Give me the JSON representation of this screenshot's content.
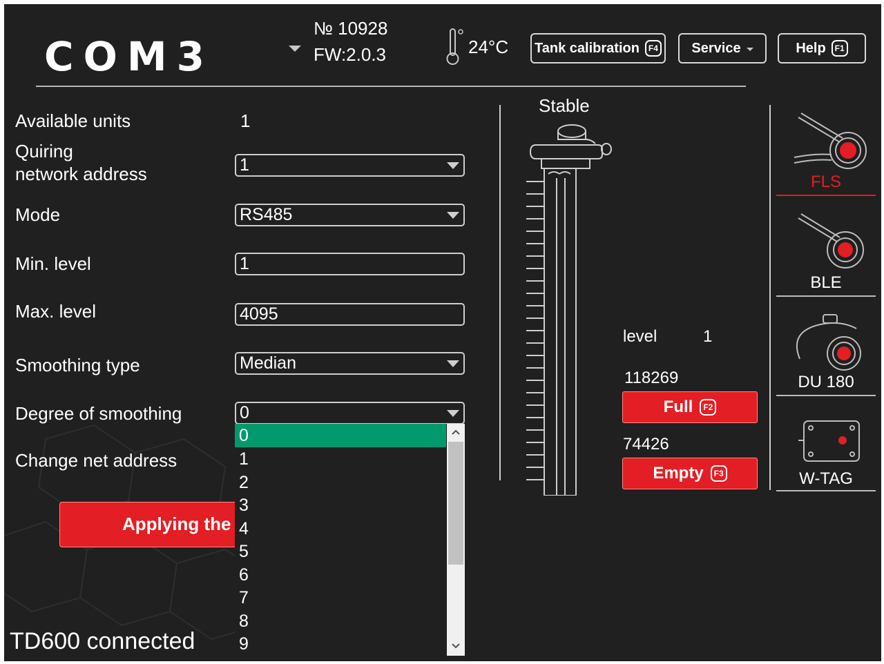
{
  "header": {
    "logo": "COM3",
    "device_number": "№ 10928",
    "firmware": "FW:2.0.3",
    "temperature": "24°C",
    "buttons": {
      "tank_calibration": "Tank calibration",
      "tank_calibration_key": "F4",
      "service": "Service",
      "help": "Help",
      "help_key": "F1"
    }
  },
  "settings": {
    "available_units_label": "Available units",
    "available_units_value": "1",
    "quiring_label_1": "Quiring",
    "quiring_label_2": "network address",
    "quiring_value": "1",
    "mode_label": "Mode",
    "mode_value": "RS485",
    "min_level_label": "Min. level",
    "min_level_value": "1",
    "max_level_label": "Max. level",
    "max_level_value": "4095",
    "smoothing_type_label": "Smoothing type",
    "smoothing_type_value": "Median",
    "degree_label": "Degree of smoothing",
    "degree_value": "0",
    "change_net_label": "Change net address",
    "apply_button": "Applying the s"
  },
  "degree_options": [
    "0",
    "1",
    "2",
    "3",
    "4",
    "5",
    "6",
    "7",
    "8",
    "9"
  ],
  "degree_selected_index": 0,
  "sensor_view": {
    "status": "Stable",
    "level_label": "level",
    "level_value": "1",
    "full_value": "118269",
    "full_button": "Full",
    "full_key": "F2",
    "empty_value": "74426",
    "empty_button": "Empty",
    "empty_key": "F3"
  },
  "sensor_types": [
    {
      "label": "FLS",
      "active": true
    },
    {
      "label": "BLE",
      "active": false
    },
    {
      "label": "DU 180",
      "active": false
    },
    {
      "label": "W-TAG",
      "active": false
    }
  ],
  "footer": {
    "connection_status": "TD600 connected"
  },
  "colors": {
    "background": "#202020",
    "accent_red": "#e31e24",
    "selection_green": "#009a6d",
    "active_tab": "#e31e24"
  }
}
